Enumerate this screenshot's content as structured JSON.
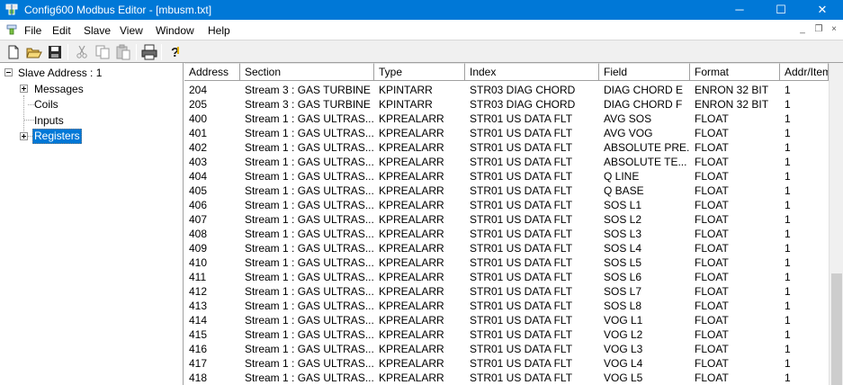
{
  "window": {
    "title": "Config600 Modbus Editor - [mbusm.txt]",
    "icon": "config600-app-icon",
    "controls": {
      "minimize": "─",
      "maximize": "☐",
      "close": "✕"
    }
  },
  "menubar": {
    "items": [
      {
        "label": "File"
      },
      {
        "label": "Edit"
      },
      {
        "label": "Slave"
      },
      {
        "label": "View"
      },
      {
        "label": "Window"
      },
      {
        "label": "Help"
      }
    ],
    "mdi_controls": {
      "minimize": "_",
      "restore": "❐",
      "close": "×"
    }
  },
  "toolbar": {
    "buttons": [
      {
        "name": "new-document-icon"
      },
      {
        "name": "open-folder-icon"
      },
      {
        "name": "save-icon"
      },
      {
        "name": "cut-icon"
      },
      {
        "name": "copy-icon"
      },
      {
        "name": "paste-icon"
      },
      {
        "name": "print-icon"
      },
      {
        "name": "help-icon"
      }
    ]
  },
  "tree": {
    "root": "Slave Address : 1",
    "children": [
      {
        "label": "Messages",
        "expandable": true
      },
      {
        "label": "Coils",
        "expandable": false
      },
      {
        "label": "Inputs",
        "expandable": false
      },
      {
        "label": "Registers",
        "expandable": true,
        "selected": true
      }
    ]
  },
  "grid": {
    "columns": [
      "Address",
      "Section",
      "Type",
      "Index",
      "Field",
      "Format",
      "Addr/Item"
    ],
    "rows": [
      [
        "204",
        "Stream 3 : GAS TURBINE",
        "KPINTARR",
        "STR03 DIAG CHORD",
        "DIAG CHORD E",
        "ENRON 32 BIT",
        "1"
      ],
      [
        "205",
        "Stream 3 : GAS TURBINE",
        "KPINTARR",
        "STR03 DIAG CHORD",
        "DIAG CHORD F",
        "ENRON 32 BIT",
        "1"
      ],
      [
        "400",
        "Stream 1 : GAS ULTRAS...",
        "KPREALARR",
        "STR01 US DATA FLT",
        "AVG SOS",
        "FLOAT",
        "1"
      ],
      [
        "401",
        "Stream 1 : GAS ULTRAS...",
        "KPREALARR",
        "STR01 US DATA FLT",
        "AVG VOG",
        "FLOAT",
        "1"
      ],
      [
        "402",
        "Stream 1 : GAS ULTRAS...",
        "KPREALARR",
        "STR01 US DATA FLT",
        "ABSOLUTE PRE...",
        "FLOAT",
        "1"
      ],
      [
        "403",
        "Stream 1 : GAS ULTRAS...",
        "KPREALARR",
        "STR01 US DATA FLT",
        "ABSOLUTE TE...",
        "FLOAT",
        "1"
      ],
      [
        "404",
        "Stream 1 : GAS ULTRAS...",
        "KPREALARR",
        "STR01 US DATA FLT",
        "Q LINE",
        "FLOAT",
        "1"
      ],
      [
        "405",
        "Stream 1 : GAS ULTRAS...",
        "KPREALARR",
        "STR01 US DATA FLT",
        "Q BASE",
        "FLOAT",
        "1"
      ],
      [
        "406",
        "Stream 1 : GAS ULTRAS...",
        "KPREALARR",
        "STR01 US DATA FLT",
        "SOS L1",
        "FLOAT",
        "1"
      ],
      [
        "407",
        "Stream 1 : GAS ULTRAS...",
        "KPREALARR",
        "STR01 US DATA FLT",
        "SOS L2",
        "FLOAT",
        "1"
      ],
      [
        "408",
        "Stream 1 : GAS ULTRAS...",
        "KPREALARR",
        "STR01 US DATA FLT",
        "SOS L3",
        "FLOAT",
        "1"
      ],
      [
        "409",
        "Stream 1 : GAS ULTRAS...",
        "KPREALARR",
        "STR01 US DATA FLT",
        "SOS L4",
        "FLOAT",
        "1"
      ],
      [
        "410",
        "Stream 1 : GAS ULTRAS...",
        "KPREALARR",
        "STR01 US DATA FLT",
        "SOS L5",
        "FLOAT",
        "1"
      ],
      [
        "411",
        "Stream 1 : GAS ULTRAS...",
        "KPREALARR",
        "STR01 US DATA FLT",
        "SOS L6",
        "FLOAT",
        "1"
      ],
      [
        "412",
        "Stream 1 : GAS ULTRAS...",
        "KPREALARR",
        "STR01 US DATA FLT",
        "SOS L7",
        "FLOAT",
        "1"
      ],
      [
        "413",
        "Stream 1 : GAS ULTRAS...",
        "KPREALARR",
        "STR01 US DATA FLT",
        "SOS L8",
        "FLOAT",
        "1"
      ],
      [
        "414",
        "Stream 1 : GAS ULTRAS...",
        "KPREALARR",
        "STR01 US DATA FLT",
        "VOG L1",
        "FLOAT",
        "1"
      ],
      [
        "415",
        "Stream 1 : GAS ULTRAS...",
        "KPREALARR",
        "STR01 US DATA FLT",
        "VOG L2",
        "FLOAT",
        "1"
      ],
      [
        "416",
        "Stream 1 : GAS ULTRAS...",
        "KPREALARR",
        "STR01 US DATA FLT",
        "VOG L3",
        "FLOAT",
        "1"
      ],
      [
        "417",
        "Stream 1 : GAS ULTRAS...",
        "KPREALARR",
        "STR01 US DATA FLT",
        "VOG L4",
        "FLOAT",
        "1"
      ],
      [
        "418",
        "Stream 1 : GAS ULTRAS...",
        "KPREALARR",
        "STR01 US DATA FLT",
        "VOG L5",
        "FLOAT",
        "1"
      ]
    ]
  },
  "colors": {
    "titlebar": "#0078d7",
    "selection": "#0078d7",
    "toolbar_bg": "#f0f0f0",
    "grid_line": "#a0a0a0"
  }
}
